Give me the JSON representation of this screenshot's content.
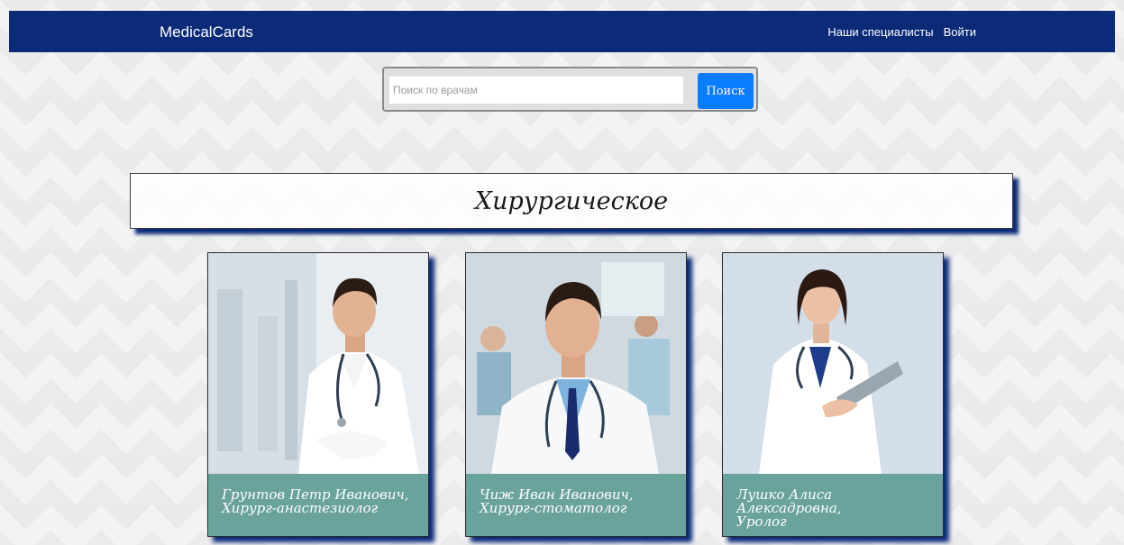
{
  "navbar": {
    "brand": "MedicalCards",
    "links": [
      "Наши специалисты",
      "Войти"
    ]
  },
  "search": {
    "placeholder": "Поиск по врачам",
    "value": "",
    "button_label": "Поиск"
  },
  "section": {
    "title": "Хирургическое"
  },
  "doctors": [
    {
      "name_line1": "Грунтов Петр Иванович,",
      "name_line2": "Хирург-анастезиолог",
      "name_line3": ""
    },
    {
      "name_line1": "Чиж Иван Иванович,",
      "name_line2": "Хирург-стоматолог",
      "name_line3": ""
    },
    {
      "name_line1": "Лушко Алиса",
      "name_line2": "Алексадровна,",
      "name_line3": "Уролог"
    }
  ],
  "colors": {
    "navbar": "#0b2a78",
    "accent_button": "#0a7cff",
    "card_caption": "#6aa29c",
    "shadow": "#0b2a78"
  },
  "icons": [
    "doctor-photo",
    "doctor-photo",
    "doctor-photo"
  ]
}
